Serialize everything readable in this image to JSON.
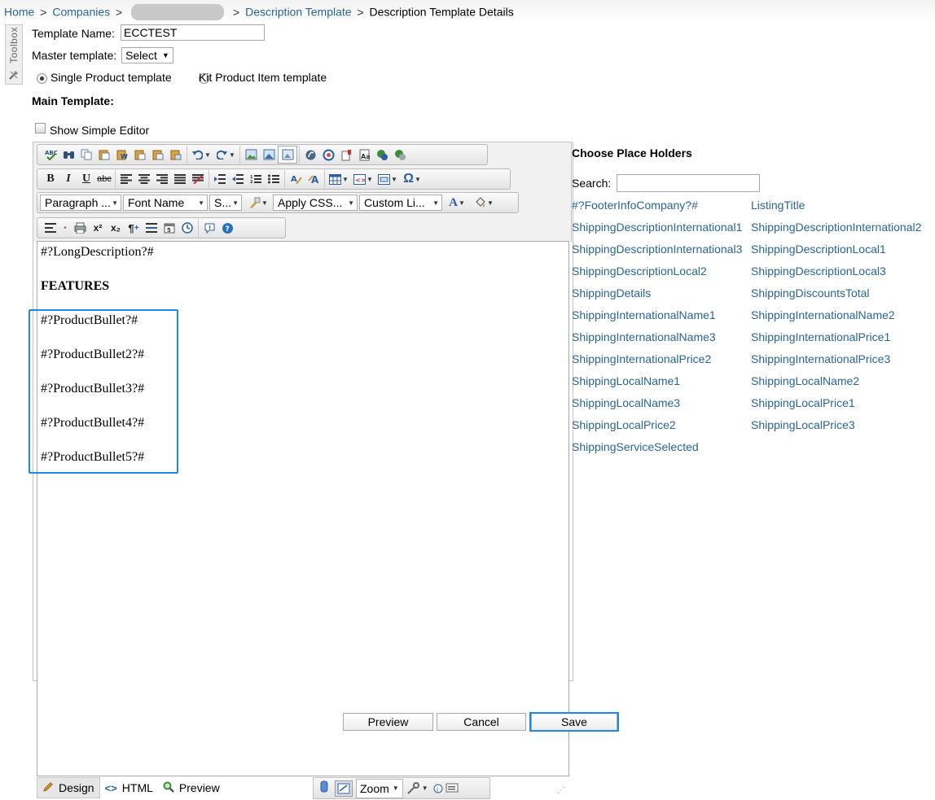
{
  "breadcrumb": {
    "home": "Home",
    "companies": "Companies",
    "description_template": "Description Template",
    "current": "Description Template Details",
    "sep": ">"
  },
  "toolbox": {
    "label": "Toolbox"
  },
  "form": {
    "template_name_label": "Template Name:",
    "template_name_value": "ECCTEST",
    "master_template_label": "Master template:",
    "master_template_value": "Select",
    "radio_single_label": "Single Product template",
    "radio_kit_label": "Kit Product Item template",
    "single_selected": true,
    "main_template_label": "Main Template:",
    "show_simple_editor_label": "Show Simple Editor"
  },
  "editor": {
    "toolbar": {
      "paragraph": "Paragraph ...",
      "font_name": "Font Name",
      "size": "S...",
      "apply_css": "Apply CSS...",
      "custom_links": "Custom Li...",
      "bold": "B",
      "italic": "I",
      "underline": "U",
      "strike": "abc",
      "omega": "Ω",
      "superscript": "x²",
      "subscript": "x₂",
      "font_color": "A"
    },
    "content": {
      "line1": "#?LongDescription?#",
      "heading": "FEATURES",
      "bullets": [
        "#?ProductBullet?#",
        "#?ProductBullet2?#",
        "#?ProductBullet3?#",
        "#?ProductBullet4?#",
        "#?ProductBullet5?#"
      ]
    },
    "buttons": {
      "preview": "Preview",
      "cancel": "Cancel",
      "save": "Save"
    },
    "modes": {
      "design": "Design",
      "html": "HTML",
      "preview": "Preview"
    },
    "zoom_label": "Zoom"
  },
  "placeholders": {
    "title": "Choose Place Holders",
    "search_label": "Search:",
    "search_value": "",
    "items": [
      "#?FooterInfoCompany?#",
      "ListingTitle",
      "ShippingDescriptionInternational1",
      "ShippingDescriptionInternational2",
      "ShippingDescriptionInternational3",
      "ShippingDescriptionLocal1",
      "ShippingDescriptionLocal2",
      "ShippingDescriptionLocal3",
      "ShippingDetails",
      "ShippingDiscountsTotal",
      "ShippingInternationalName1",
      "ShippingInternationalName2",
      "ShippingInternationalName3",
      "ShippingInternationalPrice1",
      "ShippingInternationalPrice2",
      "ShippingInternationalPrice3",
      "ShippingLocalName1",
      "ShippingLocalName2",
      "ShippingLocalName3",
      "ShippingLocalPrice1",
      "ShippingLocalPrice2",
      "ShippingLocalPrice3",
      "ShippingServiceSelected"
    ]
  },
  "colors": {
    "link": "#2a6496",
    "highlight": "#1e88e5"
  }
}
